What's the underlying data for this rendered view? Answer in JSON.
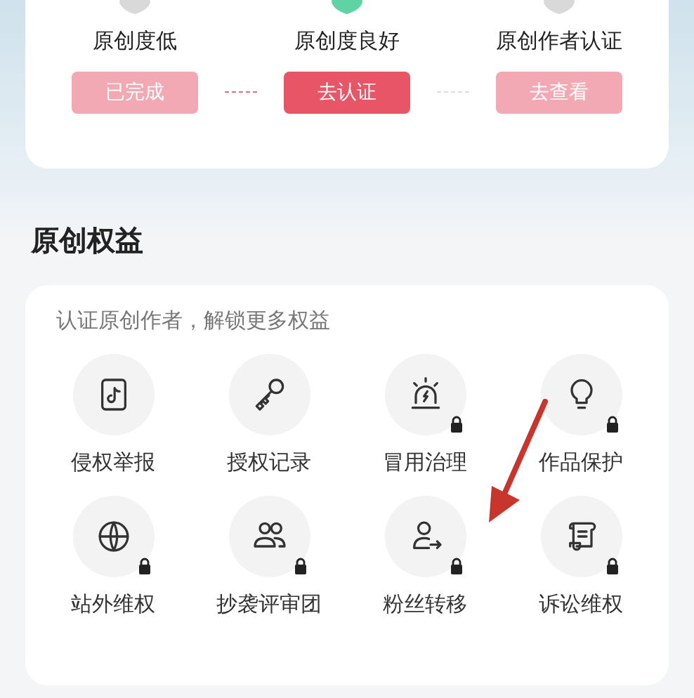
{
  "steps": [
    {
      "label": "原创度低",
      "button": "已完成",
      "active": false
    },
    {
      "label": "原创度良好",
      "button": "去认证",
      "active": true
    },
    {
      "label": "原创作者认证",
      "button": "去查看",
      "active": false
    }
  ],
  "section": {
    "title": "原创权益",
    "subtitle": "认证原创作者，解锁更多权益",
    "items": [
      {
        "label": "侵权举报",
        "locked": false
      },
      {
        "label": "授权记录",
        "locked": false
      },
      {
        "label": "冒用治理",
        "locked": true
      },
      {
        "label": "作品保护",
        "locked": true
      },
      {
        "label": "站外维权",
        "locked": true
      },
      {
        "label": "抄袭评审团",
        "locked": true
      },
      {
        "label": "粉丝转移",
        "locked": true
      },
      {
        "label": "诉讼维权",
        "locked": true
      }
    ]
  },
  "annotation": {
    "kind": "arrow"
  }
}
